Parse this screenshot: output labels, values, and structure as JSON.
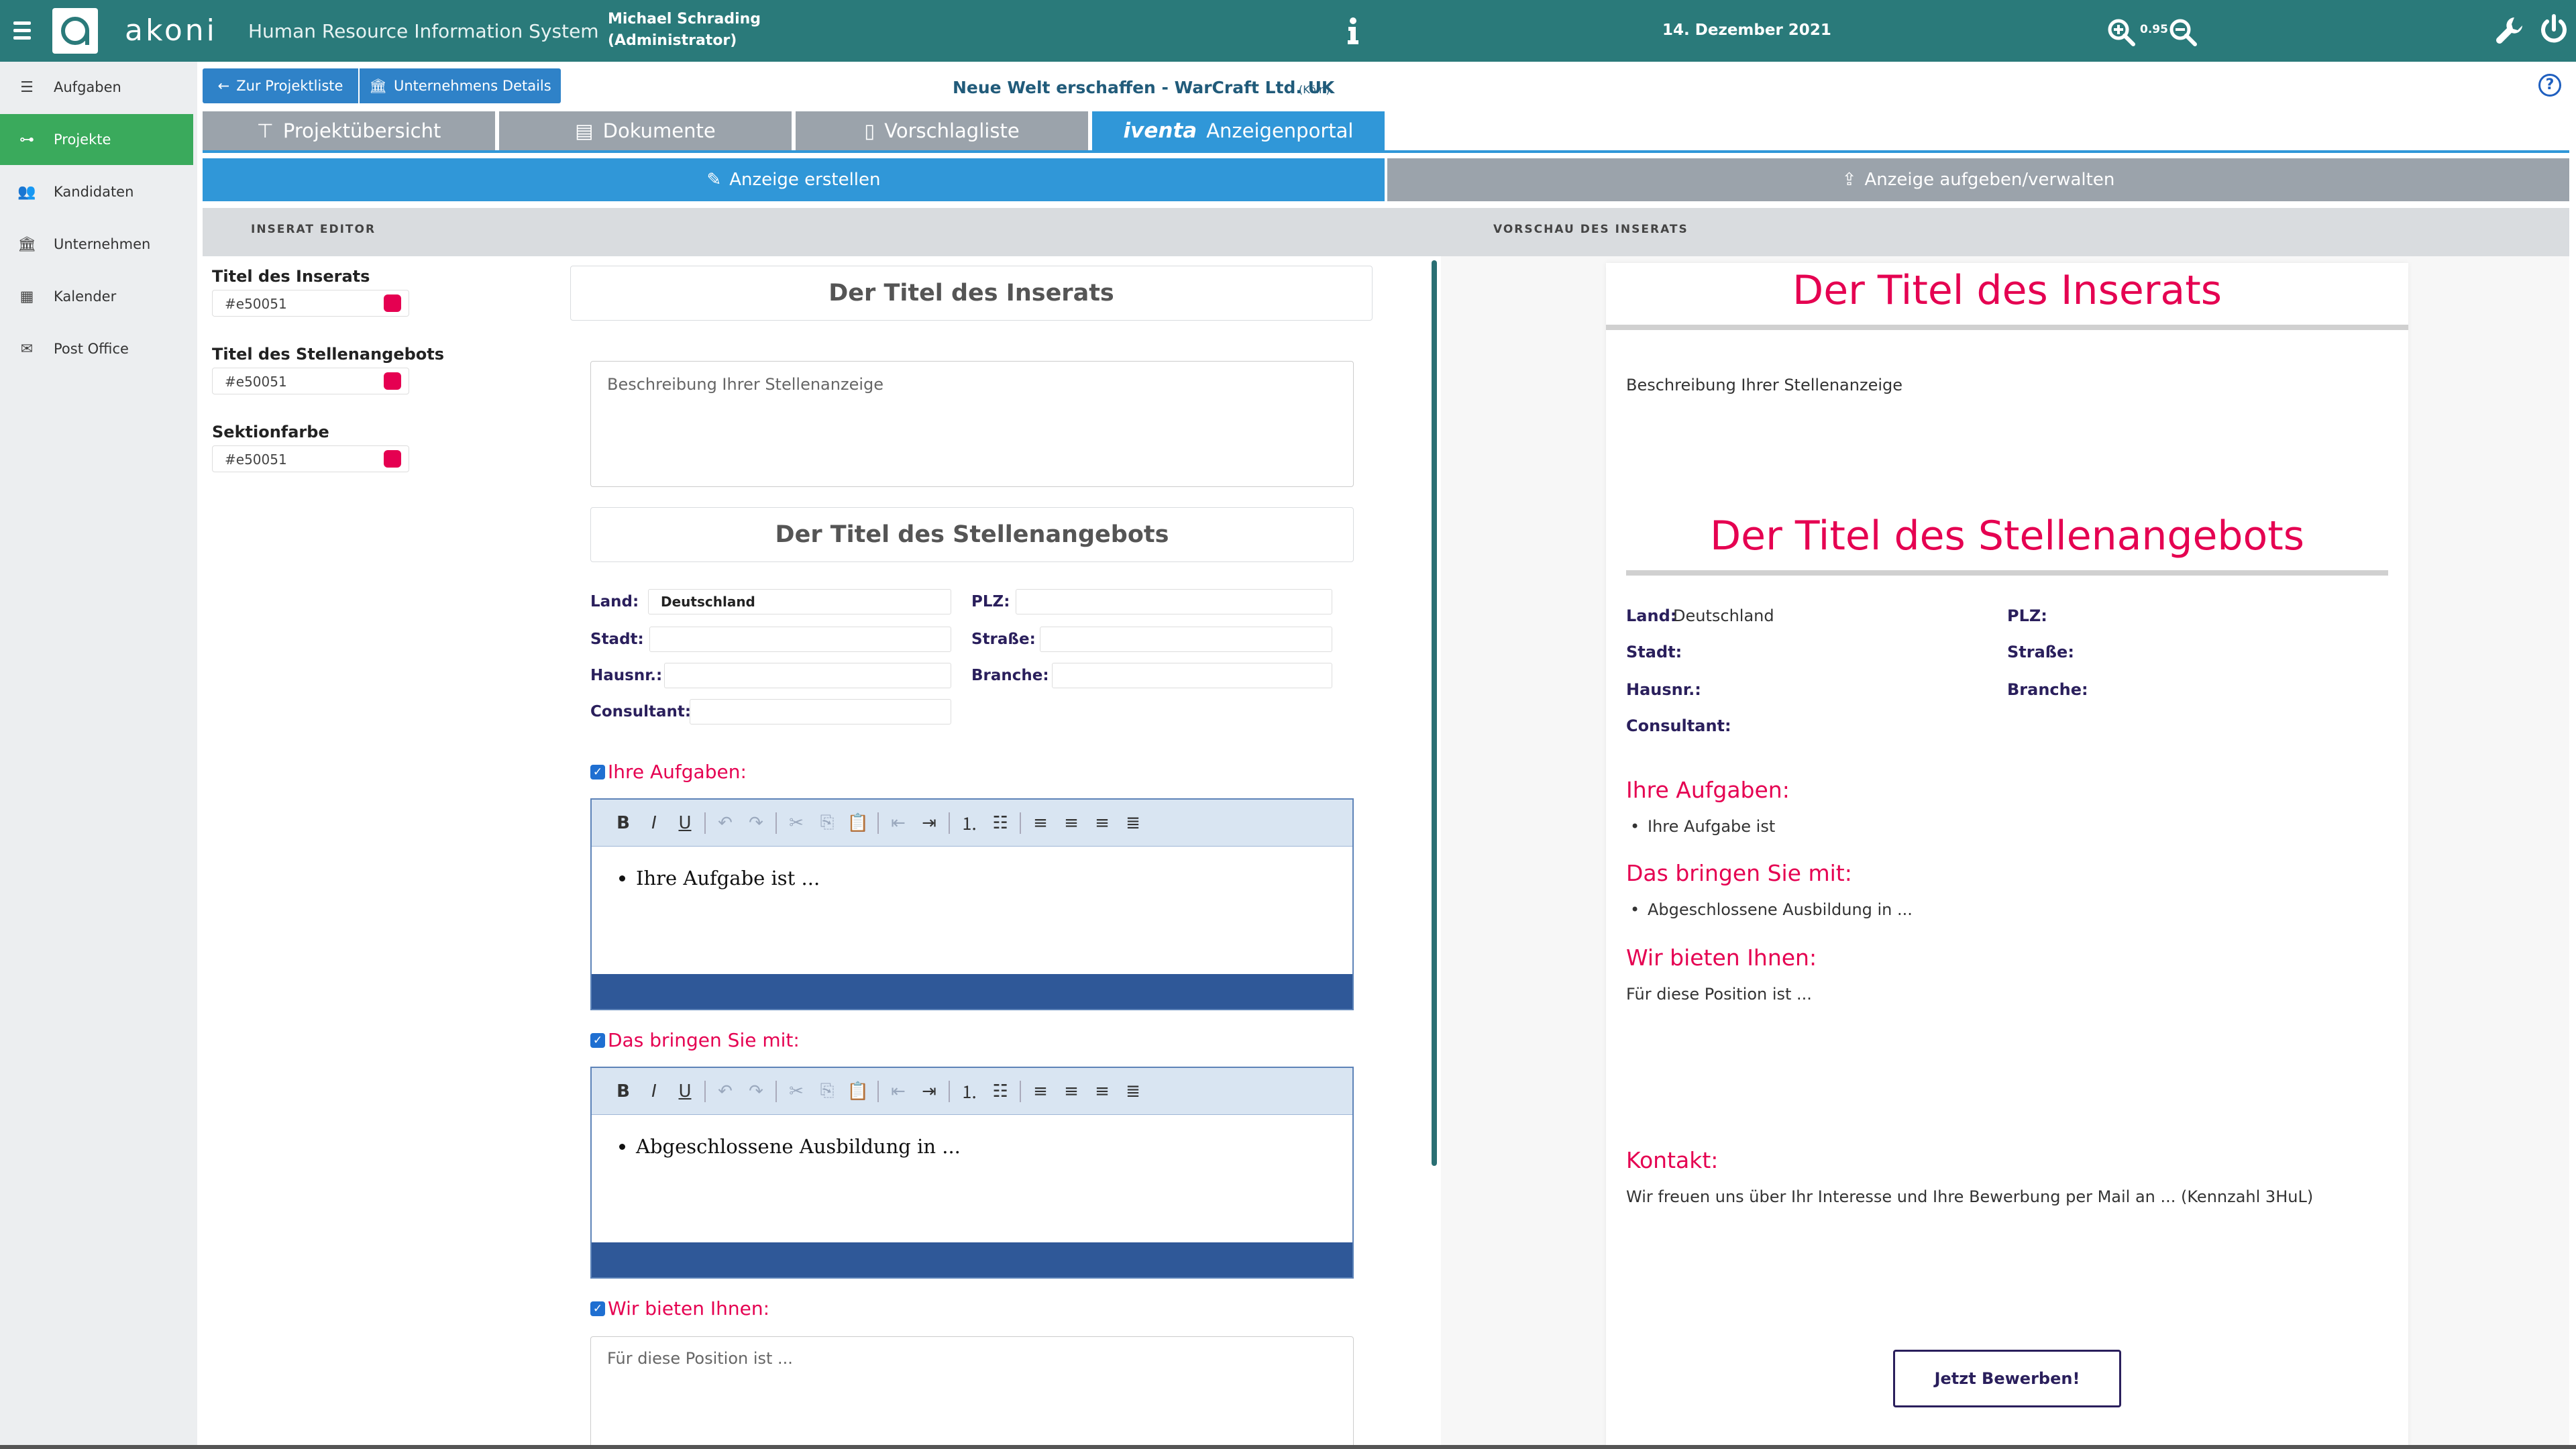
{
  "header": {
    "brand": "akoni",
    "system_name": "Human Resource Information System",
    "user_name": "Michael Schrading",
    "user_role": "(Administrator)",
    "date": "14. Dezember 2021",
    "zoom_level": "0.95"
  },
  "sidebar": {
    "items": [
      {
        "label": "Aufgaben",
        "icon": "list-icon",
        "active": false
      },
      {
        "label": "Projekte",
        "icon": "project-icon",
        "active": true
      },
      {
        "label": "Kandidaten",
        "icon": "users-icon",
        "active": false
      },
      {
        "label": "Unternehmen",
        "icon": "building-icon",
        "active": false
      },
      {
        "label": "Kalender",
        "icon": "calendar-icon",
        "active": false
      },
      {
        "label": "Post Office",
        "icon": "mail-icon",
        "active": false
      }
    ]
  },
  "toolbar": {
    "back_label": "Zur Projektliste",
    "company_label": "Unternehmens Details",
    "project_title": "Neue Welt erschaffen - WarCraft Ltd. UK",
    "project_city": "(Köln)"
  },
  "tabs": [
    {
      "label": "Projektübersicht",
      "icon": "sitemap-icon",
      "active": false
    },
    {
      "label": "Dokumente",
      "icon": "document-icon",
      "active": false
    },
    {
      "label": "Vorschlagliste",
      "icon": "file-icon",
      "active": false
    },
    {
      "label": "Anzeigenportal",
      "logo": "iventa",
      "active": true
    }
  ],
  "subtabs": [
    {
      "label": "Anzeige erstellen",
      "icon": "pencil-icon",
      "active": true
    },
    {
      "label": "Anzeige aufgeben/verwalten",
      "icon": "upload-icon",
      "active": false
    }
  ],
  "sections": {
    "editor": "INSERAT EDITOR",
    "preview": "VORSCHAU DES INSERATS"
  },
  "colors": {
    "accent": "#e50051",
    "teal": "#2a7a7a",
    "tab_active": "#3097d8",
    "tab_inactive": "#9ba3ab",
    "sidebar_active": "#3aaa5c"
  },
  "color_pickers": [
    {
      "label": "Titel des Inserats",
      "value": "#e50051"
    },
    {
      "label": "Titel des Stellenangebots",
      "value": "#e50051"
    },
    {
      "label": "Sektionfarbe",
      "value": "#e50051"
    }
  ],
  "editor": {
    "ad_title": "Der Titel des Inserats",
    "description_placeholder": "Beschreibung Ihrer Stellenanzeige",
    "job_title": "Der Titel des Stellenangebots",
    "fields": {
      "land_label": "Land:",
      "land_value": "Deutschland",
      "plz_label": "PLZ:",
      "plz_value": "",
      "stadt_label": "Stadt:",
      "stadt_value": "",
      "strasse_label": "Straße:",
      "strasse_value": "",
      "hausnr_label": "Hausnr.:",
      "hausnr_value": "",
      "branche_label": "Branche:",
      "branche_value": "",
      "consultant_label": "Consultant:",
      "consultant_value": ""
    },
    "tasks_label": "Ihre Aufgaben:",
    "tasks_item": "Ihre Aufgabe ist ...",
    "requirements_label": "Das bringen Sie mit:",
    "requirements_item": "Abgeschlossene Ausbildung in ...",
    "offer_label": "Wir bieten Ihnen:",
    "offer_placeholder": "Für diese Position ist ..."
  },
  "preview": {
    "ad_title": "Der Titel des Inserats",
    "description": "Beschreibung Ihrer Stellenanzeige",
    "job_title": "Der Titel des Stellenangebots",
    "land_label": "Land:",
    "land_value": "Deutschland",
    "plz_label": "PLZ:",
    "stadt_label": "Stadt:",
    "strasse_label": "Straße:",
    "hausnr_label": "Hausnr.:",
    "branche_label": "Branche:",
    "consultant_label": "Consultant:",
    "tasks_label": "Ihre Aufgaben:",
    "tasks_item": "Ihre Aufgabe ist",
    "requirements_label": "Das bringen Sie mit:",
    "requirements_item": "Abgeschlossene Ausbildung in ...",
    "offer_label": "Wir bieten Ihnen:",
    "offer_text": "Für diese Position ist ...",
    "contact_label": "Kontakt:",
    "contact_text": "Wir freuen uns über Ihr Interesse und Ihre Bewerbung per Mail an ... (Kennzahl 3HuL)",
    "apply_label": "Jetzt Bewerben!"
  }
}
